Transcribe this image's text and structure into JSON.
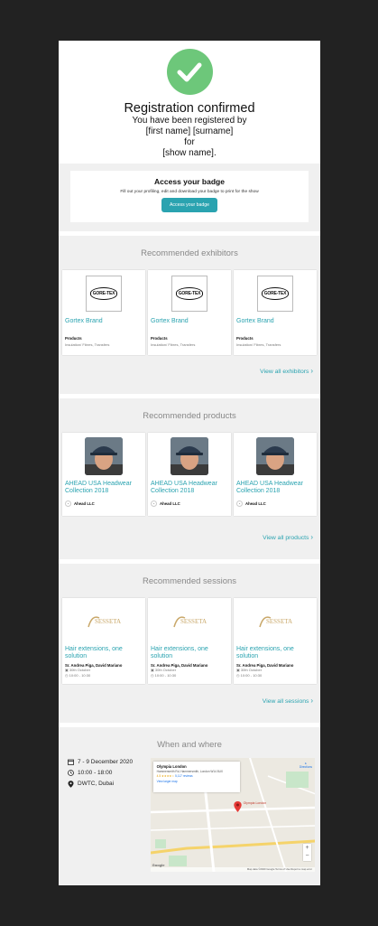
{
  "hero": {
    "title": "Registration confirmed",
    "line1": "You have been registered by",
    "line2": "[first name] [surname]",
    "line3": "for",
    "line4": "[show name]."
  },
  "badge": {
    "title": "Access your badge",
    "description": "Fill out your profiling, edit and download your badge to print for the show",
    "button": "Access your badge"
  },
  "exhibitors": {
    "title": "Recommended exhibitors",
    "logo_text": "GORE-TEX",
    "items": [
      {
        "name": "Gortex Brand",
        "label": "Products",
        "sub": "Insulation/ Fibres, Transfers"
      },
      {
        "name": "Gortex Brand",
        "label": "Products",
        "sub": "Insulation/ Fibres, Transfers"
      },
      {
        "name": "Gortex Brand",
        "label": "Products",
        "sub": "Insulation/ Fibres, Transfers"
      }
    ],
    "view_all": "View all exhibitors"
  },
  "products": {
    "title": "Recommended products",
    "items": [
      {
        "name": "AHEAD USA Headwear Collection 2018",
        "company": "Ahead LLC"
      },
      {
        "name": "AHEAD USA Headwear Collection 2018",
        "company": "Ahead LLC"
      },
      {
        "name": "AHEAD USA Headwear Collection 2018",
        "company": "Ahead LLC"
      }
    ],
    "view_all": "View all products"
  },
  "sessions": {
    "title": "Recommended sessions",
    "logo_text": "SESSETA",
    "items": [
      {
        "name": "Hair extensions, one solution",
        "speakers": "Sr. Andrea Piga, David Mariano",
        "date": "30th October",
        "time": "10:00 - 10:30"
      },
      {
        "name": "Hair extensions, one solution",
        "speakers": "Sr. Andrea Piga, David Mariano",
        "date": "30th October",
        "time": "10:00 - 10:30"
      },
      {
        "name": "Hair extensions, one solution",
        "speakers": "Sr. Andrea Piga, David Mariano",
        "date": "30th October",
        "time": "10:00 - 10:30"
      }
    ],
    "view_all": "View all sessions"
  },
  "when_where": {
    "title": "When and where",
    "dates": "7 - 9 December 2020",
    "time": "10:00 - 18:00",
    "location": "DWTC, Dubai"
  },
  "map": {
    "place": "Olympia London",
    "address": "Hammersmith Rd, Hammersmith, London W14 8UX",
    "rating": "4.5 ★★★★☆",
    "reviews": "5,117 reviews",
    "directions": "Directions",
    "larger_map": "View larger map",
    "pin_label": "Olympia London",
    "footer": "Map data ©2020 Google   Terms of Use   Report a map error",
    "logo": "Google"
  },
  "colors": {
    "accent": "#2aa3b0",
    "check": "#6dc77a"
  }
}
